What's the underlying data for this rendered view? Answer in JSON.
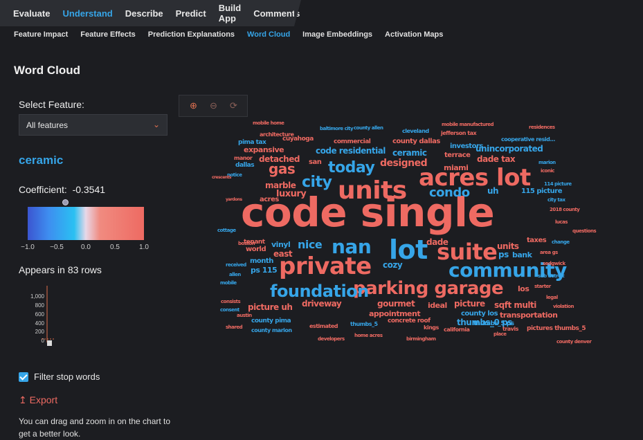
{
  "topnav": {
    "tabs": [
      "Evaluate",
      "Understand",
      "Describe",
      "Predict",
      "Build App",
      "Comments"
    ],
    "active": 1
  },
  "subnav": {
    "tabs": [
      "Feature Impact",
      "Feature Effects",
      "Prediction Explanations",
      "Word Cloud",
      "Image Embeddings",
      "Activation Maps"
    ],
    "active": 3
  },
  "page_title": "Word Cloud",
  "select": {
    "label": "Select Feature:",
    "value": "All features"
  },
  "selected_word": "ceramic",
  "coefficient": {
    "label": "Coefficient:",
    "value": "-0.3541"
  },
  "colorbar": {
    "ticks": [
      "−1.0",
      "−0.5",
      "0.0",
      "0.5",
      "1.0"
    ],
    "colors": [
      "#3b55d0",
      "#2ac0f2",
      "#e8d8e8",
      "#ee6a62"
    ]
  },
  "appears": "Appears in 83 rows",
  "histogram": {
    "ticks": [
      "1,000",
      "800",
      "600",
      "400",
      "200",
      "0"
    ]
  },
  "filter_label": "Filter stop words",
  "export_label": "Export",
  "hint": "You can drag and zoom in on the chart to get a better look.",
  "colors": {
    "blue": "#36a5e8",
    "red": "#ee6a62"
  },
  "words": [
    {
      "t": "code single",
      "c": "r",
      "s": 58
    },
    {
      "t": "units",
      "c": "r",
      "s": 36
    },
    {
      "t": "acres lot",
      "c": "r",
      "s": 34
    },
    {
      "t": "private",
      "c": "r",
      "s": 34
    },
    {
      "t": "lot",
      "c": "b",
      "s": 38
    },
    {
      "t": "nan",
      "c": "b",
      "s": 28
    },
    {
      "t": "suite",
      "c": "r",
      "s": 32
    },
    {
      "t": "community",
      "c": "b",
      "s": 28
    },
    {
      "t": "parking garage",
      "c": "r",
      "s": 26
    },
    {
      "t": "foundation",
      "c": "b",
      "s": 24
    },
    {
      "t": "today",
      "c": "b",
      "s": 22
    },
    {
      "t": "city",
      "c": "b",
      "s": 22
    },
    {
      "t": "gas",
      "c": "r",
      "s": 20
    },
    {
      "t": "condo",
      "c": "b",
      "s": 18
    },
    {
      "t": "designed",
      "c": "r",
      "s": 14
    },
    {
      "t": "nice",
      "c": "b",
      "s": 16
    },
    {
      "t": "luxury",
      "c": "r",
      "s": 13
    },
    {
      "t": "marble",
      "c": "r",
      "s": 12
    },
    {
      "t": "detached",
      "c": "r",
      "s": 12
    },
    {
      "t": "expansive",
      "c": "r",
      "s": 11
    },
    {
      "t": "code residential",
      "c": "b",
      "s": 12
    },
    {
      "t": "ceramic",
      "c": "b",
      "s": 12
    },
    {
      "t": "unincorporated",
      "c": "b",
      "s": 12
    },
    {
      "t": "dade tax",
      "c": "r",
      "s": 12
    },
    {
      "t": "miami",
      "c": "r",
      "s": 11
    },
    {
      "t": "terrace",
      "c": "r",
      "s": 10
    },
    {
      "t": "investors",
      "c": "b",
      "s": 10
    },
    {
      "t": "county dallas",
      "c": "r",
      "s": 10
    },
    {
      "t": "115 picture",
      "c": "b",
      "s": 10
    },
    {
      "t": "uh",
      "c": "b",
      "s": 12
    },
    {
      "t": "san",
      "c": "r",
      "s": 10
    },
    {
      "t": "acres",
      "c": "r",
      "s": 10
    },
    {
      "t": "dallas",
      "c": "b",
      "s": 9
    },
    {
      "t": "manor",
      "c": "r",
      "s": 8
    },
    {
      "t": "world",
      "c": "r",
      "s": 10
    },
    {
      "t": "east",
      "c": "r",
      "s": 12
    },
    {
      "t": "vinyl",
      "c": "b",
      "s": 11
    },
    {
      "t": "tenant",
      "c": "r",
      "s": 9
    },
    {
      "t": "dade",
      "c": "r",
      "s": 12
    },
    {
      "t": "units",
      "c": "r",
      "s": 12
    },
    {
      "t": "ps",
      "c": "b",
      "s": 12
    },
    {
      "t": "bank",
      "c": "b",
      "s": 11
    },
    {
      "t": "taxes",
      "c": "r",
      "s": 10
    },
    {
      "t": "month",
      "c": "b",
      "s": 10
    },
    {
      "t": "ps 115",
      "c": "b",
      "s": 11
    },
    {
      "t": "cozy",
      "c": "b",
      "s": 12
    },
    {
      "t": "los",
      "c": "r",
      "s": 11
    },
    {
      "t": "picture uh",
      "c": "r",
      "s": 12
    },
    {
      "t": "driveway",
      "c": "r",
      "s": 12
    },
    {
      "t": "gourmet",
      "c": "r",
      "s": 12
    },
    {
      "t": "ideal",
      "c": "r",
      "s": 11
    },
    {
      "t": "picture",
      "c": "r",
      "s": 12
    },
    {
      "t": "sqft multi",
      "c": "r",
      "s": 12
    },
    {
      "t": "appointment",
      "c": "r",
      "s": 11
    },
    {
      "t": "county los",
      "c": "b",
      "s": 10
    },
    {
      "t": "transportation",
      "c": "r",
      "s": 11
    },
    {
      "t": "thumbs_0 ps",
      "c": "b",
      "s": 12
    },
    {
      "t": "county pima",
      "c": "b",
      "s": 9
    },
    {
      "t": "concrete roof",
      "c": "r",
      "s": 9
    },
    {
      "t": "thumbs_5 ps",
      "c": "b",
      "s": 9
    },
    {
      "t": "pictures thumbs_5",
      "c": "r",
      "s": 9
    },
    {
      "t": "county marion",
      "c": "b",
      "s": 8
    },
    {
      "t": "estimated",
      "c": "r",
      "s": 8
    },
    {
      "t": "thumbs_5",
      "c": "b",
      "s": 8
    },
    {
      "t": "california",
      "c": "r",
      "s": 8
    },
    {
      "t": "kings",
      "c": "r",
      "s": 8
    },
    {
      "t": "travis",
      "c": "r",
      "s": 8
    },
    {
      "t": "commercial",
      "c": "r",
      "s": 9
    },
    {
      "t": "cuyahoga",
      "c": "r",
      "s": 9
    },
    {
      "t": "architecture",
      "c": "r",
      "s": 8
    },
    {
      "t": "pima tax",
      "c": "b",
      "s": 9
    },
    {
      "t": "cleveland",
      "c": "b",
      "s": 8
    },
    {
      "t": "jefferson tax",
      "c": "r",
      "s": 8
    },
    {
      "t": "cooperative resid...",
      "c": "b",
      "s": 8
    },
    {
      "t": "residences",
      "c": "r",
      "s": 7
    },
    {
      "t": "baltimore city",
      "c": "b",
      "s": 7
    },
    {
      "t": "county allen",
      "c": "b",
      "s": 7
    },
    {
      "t": "mobile home",
      "c": "r",
      "s": 7
    },
    {
      "t": "mobile manufactured",
      "c": "r",
      "s": 7
    },
    {
      "t": "marion",
      "c": "b",
      "s": 7
    },
    {
      "t": "iconic",
      "c": "r",
      "s": 7
    },
    {
      "t": "area gs",
      "c": "r",
      "s": 7
    },
    {
      "t": "sedgwick",
      "c": "r",
      "s": 7
    },
    {
      "t": "sub detroit",
      "c": "b",
      "s": 7
    },
    {
      "t": "starter",
      "c": "r",
      "s": 7
    },
    {
      "t": "legal",
      "c": "r",
      "s": 7
    },
    {
      "t": "violation",
      "c": "r",
      "s": 7
    },
    {
      "t": "lucas",
      "c": "r",
      "s": 7
    },
    {
      "t": "questions",
      "c": "r",
      "s": 7
    },
    {
      "t": "change",
      "c": "b",
      "s": 7
    },
    {
      "t": "2018 county",
      "c": "r",
      "s": 7
    },
    {
      "t": "city tax",
      "c": "b",
      "s": 7
    },
    {
      "t": "114 picture",
      "c": "b",
      "s": 7
    },
    {
      "t": "yardons",
      "c": "r",
      "s": 6
    },
    {
      "t": "cottage",
      "c": "b",
      "s": 7
    },
    {
      "t": "boston",
      "c": "r",
      "s": 7
    },
    {
      "t": "received",
      "c": "b",
      "s": 7
    },
    {
      "t": "allen",
      "c": "b",
      "s": 7
    },
    {
      "t": "mobile",
      "c": "b",
      "s": 7
    },
    {
      "t": "consists",
      "c": "r",
      "s": 7
    },
    {
      "t": "consent",
      "c": "b",
      "s": 7
    },
    {
      "t": "austin",
      "c": "r",
      "s": 7
    },
    {
      "t": "shared",
      "c": "r",
      "s": 7
    },
    {
      "t": "notice",
      "c": "b",
      "s": 7
    },
    {
      "t": "crescents",
      "c": "r",
      "s": 6
    },
    {
      "t": "county denver",
      "c": "r",
      "s": 7
    },
    {
      "t": "home acres",
      "c": "r",
      "s": 7
    },
    {
      "t": "developers",
      "c": "r",
      "s": 7
    },
    {
      "t": "birmingham",
      "c": "r",
      "s": 7
    },
    {
      "t": "place",
      "c": "r",
      "s": 7
    }
  ]
}
